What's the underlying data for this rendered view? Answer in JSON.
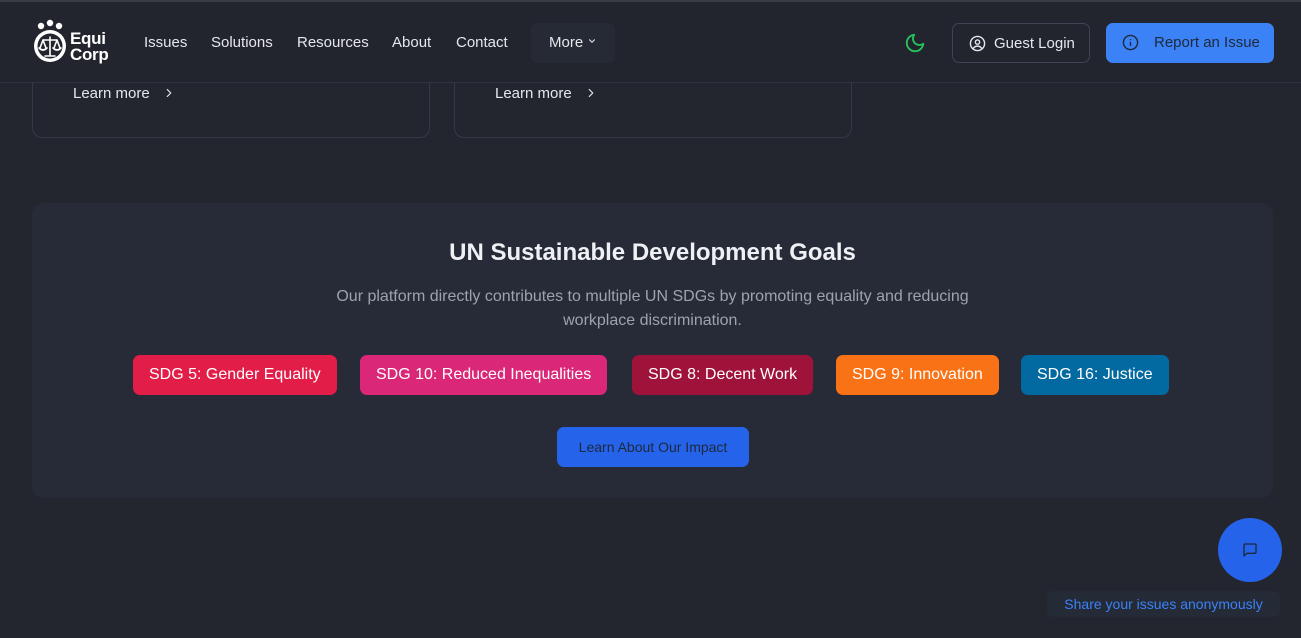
{
  "brand": {
    "line1": "Equi",
    "line2": "Corp"
  },
  "nav": {
    "items": [
      "Issues",
      "Solutions",
      "Resources",
      "About",
      "Contact"
    ],
    "more_label": "More"
  },
  "header": {
    "guest_login_label": "Guest Login",
    "report_label": "Report an Issue"
  },
  "cards": [
    {
      "link_label": "Learn more"
    },
    {
      "link_label": "Learn more"
    }
  ],
  "sdg": {
    "title": "UN Sustainable Development Goals",
    "description": "Our platform directly contributes to multiple UN SDGs by promoting equality and reducing workplace discrimination.",
    "badges": [
      {
        "label": "SDG 5: Gender Equality",
        "color": "#e11d48"
      },
      {
        "label": "SDG 10: Reduced Inequalities",
        "color": "#db2777"
      },
      {
        "label": "SDG 8: Decent Work",
        "color": "#9f1239"
      },
      {
        "label": "SDG 9: Innovation",
        "color": "#f97316"
      },
      {
        "label": "SDG 16: Justice",
        "color": "#0369a1"
      }
    ],
    "cta_label": "Learn About Our Impact"
  },
  "chat": {
    "tooltip": "Share your issues anonymously"
  },
  "colors": {
    "accent": "#3b82f6",
    "accent_dark": "#2563eb",
    "theme_icon": "#22c55e",
    "background": "#23262f"
  },
  "icons": {
    "theme": "moon-icon",
    "guest": "user-circle-icon",
    "report": "info-icon",
    "learn_more": "chevron-right-icon",
    "more": "chevron-down-icon",
    "chat": "message-square-icon"
  }
}
